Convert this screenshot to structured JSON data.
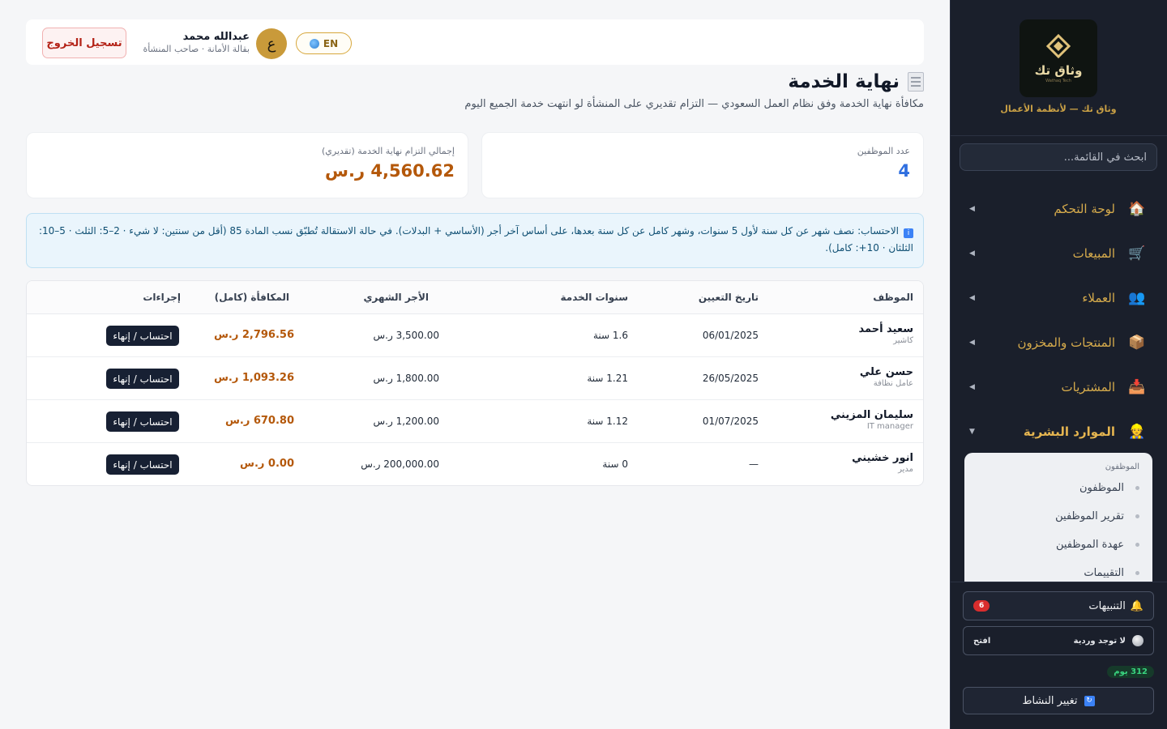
{
  "sidebar": {
    "logo_text": "وثاق تك",
    "logo_sub": "Wathaq Tech",
    "tagline": "وثاق تك — لأنظمة الأعمال",
    "search_placeholder": "ابحث في القائمة...",
    "nav": [
      {
        "label": "لوحة التحكم",
        "icon": "house-icon",
        "glyph": "🏠"
      },
      {
        "label": "المبيعات",
        "icon": "cart-icon",
        "glyph": "🛒"
      },
      {
        "label": "العملاء",
        "icon": "users-icon",
        "glyph": "👥"
      },
      {
        "label": "المنتجات والمخزون",
        "icon": "package-icon",
        "glyph": "📦"
      },
      {
        "label": "المشتريات",
        "icon": "inbox-icon",
        "glyph": "📥"
      },
      {
        "label": "الموارد البشرية",
        "icon": "worker-icon",
        "glyph": "👷"
      }
    ],
    "submenu": {
      "title": "الموظفون",
      "items": [
        "الموظفون",
        "تقرير الموظفين",
        "عهدة الموظفين",
        "التقييمات"
      ]
    },
    "alerts_label": "التنبيهات",
    "alerts_count": "6",
    "shift_label": "لا توجد وردية",
    "shift_open": "افتح",
    "days_badge": "312 يوم",
    "switch_label": "تغيير النشاط"
  },
  "header": {
    "logout_label": "تسجيل الخروج",
    "user_name": "عبدالله محمد",
    "user_role": "بقالة الأمانة · صاحب المنشأة",
    "avatar_letter": "ع",
    "lang_label": "EN"
  },
  "page": {
    "title": "نهاية الخدمة",
    "subtitle": "مكافأة نهاية الخدمة وفق نظام العمل السعودي — التزام تقديري على المنشأة لو انتهت خدمة الجميع اليوم"
  },
  "stats": {
    "employees_label": "عدد الموظفين",
    "employees_value": "4",
    "total_label": "إجمالي التزام نهاية الخدمة (تقديري)",
    "total_value": "4,560.62 ر.س"
  },
  "info": {
    "text": "الاحتساب: نصف شهر عن كل سنة لأول 5 سنوات، وشهر كامل عن كل سنة بعدها، على أساس آخر أجر (الأساسي + البدلات). في حالة الاستقالة تُطبّق نسب المادة 85 (أقل من سنتين: لا شيء · 2–5: الثلث · 5–10: الثلثان · 10+: كامل)."
  },
  "table": {
    "headers": {
      "employee": "الموظف",
      "hire_date": "تاريخ التعيين",
      "years": "سنوات الخدمة",
      "salary": "الأجر الشهري",
      "reward": "المكافأة (كامل)",
      "actions": "إجراءات"
    },
    "action_label": "احتساب / إنهاء",
    "rows": [
      {
        "name": "سعيد أحمد",
        "role": "كاشير",
        "hire_date": "06/01/2025",
        "years": "1.6 سنة",
        "salary": "3,500.00 ر.س",
        "reward": "2,796.56 ر.س"
      },
      {
        "name": "حسن علي",
        "role": "عامل نظافة",
        "hire_date": "26/05/2025",
        "years": "1.21 سنة",
        "salary": "1,800.00 ر.س",
        "reward": "1,093.26 ر.س"
      },
      {
        "name": "سليمان المزيني",
        "role": "IT manager",
        "hire_date": "01/07/2025",
        "years": "1.12 سنة",
        "salary": "1,200.00 ر.س",
        "reward": "670.80 ر.س"
      },
      {
        "name": "انور خشيني",
        "role": "مدير",
        "hire_date": "—",
        "years": "0 سنة",
        "salary": "200,000.00 ر.س",
        "reward": "0.00 ر.س"
      }
    ]
  },
  "colors": {
    "sidebar_bg": "#1a1f2b",
    "accent_gold": "#d6ab4c",
    "reward_brown": "#b4580a",
    "count_blue": "#2f6fe0",
    "action_dark": "#172033",
    "alert_red": "#d92d2d"
  }
}
